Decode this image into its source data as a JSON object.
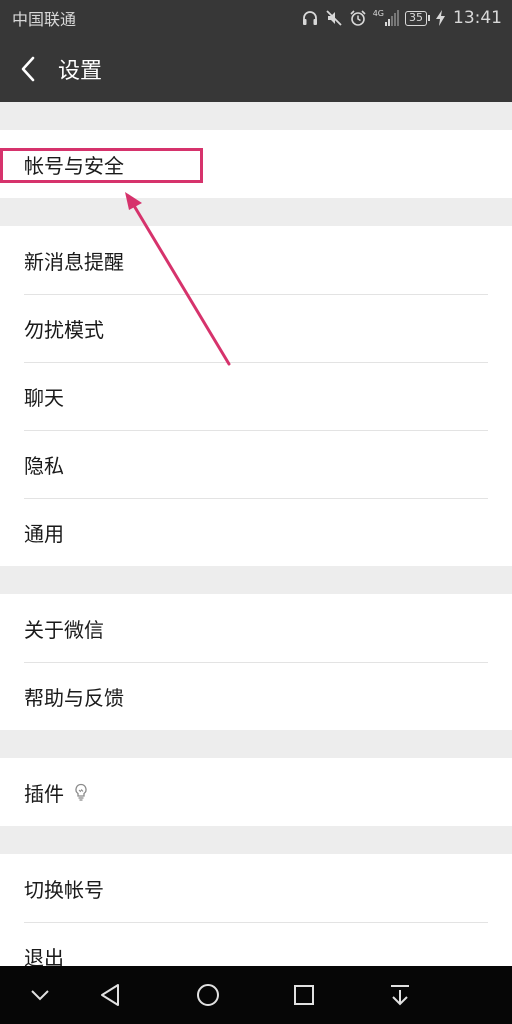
{
  "status_bar": {
    "carrier": "中国联通",
    "network": "4G",
    "battery": "35",
    "time": "13:41"
  },
  "header": {
    "title": "设置"
  },
  "groups": [
    {
      "items": [
        {
          "label": "帐号与安全"
        }
      ]
    },
    {
      "items": [
        {
          "label": "新消息提醒"
        },
        {
          "label": "勿扰模式"
        },
        {
          "label": "聊天"
        },
        {
          "label": "隐私"
        },
        {
          "label": "通用"
        }
      ]
    },
    {
      "items": [
        {
          "label": "关于微信"
        },
        {
          "label": "帮助与反馈"
        }
      ]
    },
    {
      "items": [
        {
          "label": "插件",
          "icon": "lightbulb-icon"
        }
      ]
    },
    {
      "items": [
        {
          "label": "切换帐号"
        },
        {
          "label": "退出"
        }
      ]
    }
  ],
  "annotation": {
    "color": "#d6336c"
  }
}
